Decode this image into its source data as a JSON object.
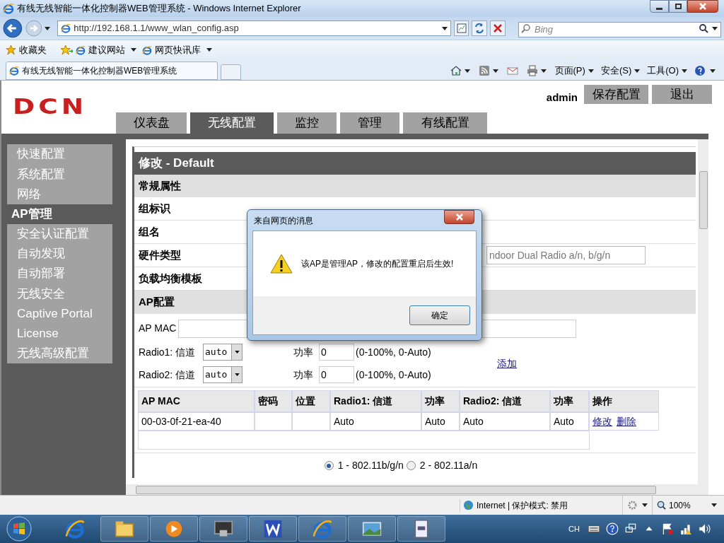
{
  "window": {
    "title": "有线无线智能一体化控制器WEB管理系统 - Windows Internet Explorer"
  },
  "address_bar": {
    "url": "http://192.168.1.1/www_wlan_config.asp"
  },
  "search": {
    "placeholder": "Bing"
  },
  "favorites_bar": {
    "items": [
      "收藏夹",
      "建议网站",
      "网页快讯库"
    ]
  },
  "browser_tab": {
    "title": "有线无线智能一体化控制器WEB管理系统"
  },
  "command_bar": {
    "items": [
      "页面(P)",
      "安全(S)",
      "工具(O)"
    ]
  },
  "page": {
    "logo": "DCN",
    "user": "admin",
    "header_buttons": [
      "保存配置",
      "退出"
    ],
    "nav_tabs": [
      {
        "label": "仪表盘",
        "selected": false
      },
      {
        "label": "无线配置",
        "selected": true
      },
      {
        "label": "监控",
        "selected": false
      },
      {
        "label": "管理",
        "selected": false
      },
      {
        "label": "有线配置",
        "selected": false
      }
    ],
    "sidebar": [
      {
        "label": "快速配置",
        "selected": false
      },
      {
        "label": "系统配置",
        "selected": false
      },
      {
        "label": "网络",
        "selected": false
      },
      {
        "label": "AP管理",
        "selected": true
      },
      {
        "label": "安全认证配置",
        "selected": false
      },
      {
        "label": "自动发现",
        "selected": false
      },
      {
        "label": "自动部署",
        "selected": false
      },
      {
        "label": "无线安全",
        "selected": false
      },
      {
        "label": "Captive Portal",
        "selected": false
      },
      {
        "label": "License",
        "selected": false
      },
      {
        "label": "无线高级配置",
        "selected": false
      }
    ],
    "form": {
      "title": "修改 - Default",
      "general_section": "常规属性",
      "fields": [
        {
          "label": "组标识"
        },
        {
          "label": "组名"
        },
        {
          "label": "硬件类型",
          "value": "ndoor Dual Radio a/n, b/g/n"
        },
        {
          "label": "负载均衡模板"
        }
      ],
      "ap_section": "AP配置",
      "ap_mac_label": "AP MAC",
      "radios": [
        {
          "label": "Radio1: 信道",
          "channel": "auto",
          "power_label": "功率",
          "power": "0",
          "hint": "(0-100%, 0-Auto)"
        },
        {
          "label": "Radio2: 信道",
          "channel": "auto",
          "power_label": "功率",
          "power": "0",
          "hint": "(0-100%, 0-Auto)"
        }
      ],
      "add_link": "添加",
      "table": {
        "columns": [
          "AP MAC",
          "密码",
          "位置",
          "Radio1: 信道",
          "功率",
          "Radio2: 信道",
          "功率",
          "操作"
        ],
        "rows": [
          {
            "cells": [
              "00-03-0f-21-ea-40",
              "",
              "",
              "Auto",
              "Auto",
              "Auto",
              "Auto"
            ],
            "actions": [
              "修改",
              "删除"
            ]
          }
        ]
      },
      "band_options": [
        {
          "label": "1 - 802.11b/g/n",
          "selected": true
        },
        {
          "label": "2 - 802.11a/n",
          "selected": false
        }
      ]
    }
  },
  "dialog": {
    "title": "来自网页的消息",
    "message": "该AP是管理AP，修改的配置重启后生效!",
    "button": "确定"
  },
  "status_bar": {
    "zone": "Internet | 保护模式: 禁用",
    "zoom": "100%"
  },
  "taskbar": {
    "language": "CH"
  }
}
